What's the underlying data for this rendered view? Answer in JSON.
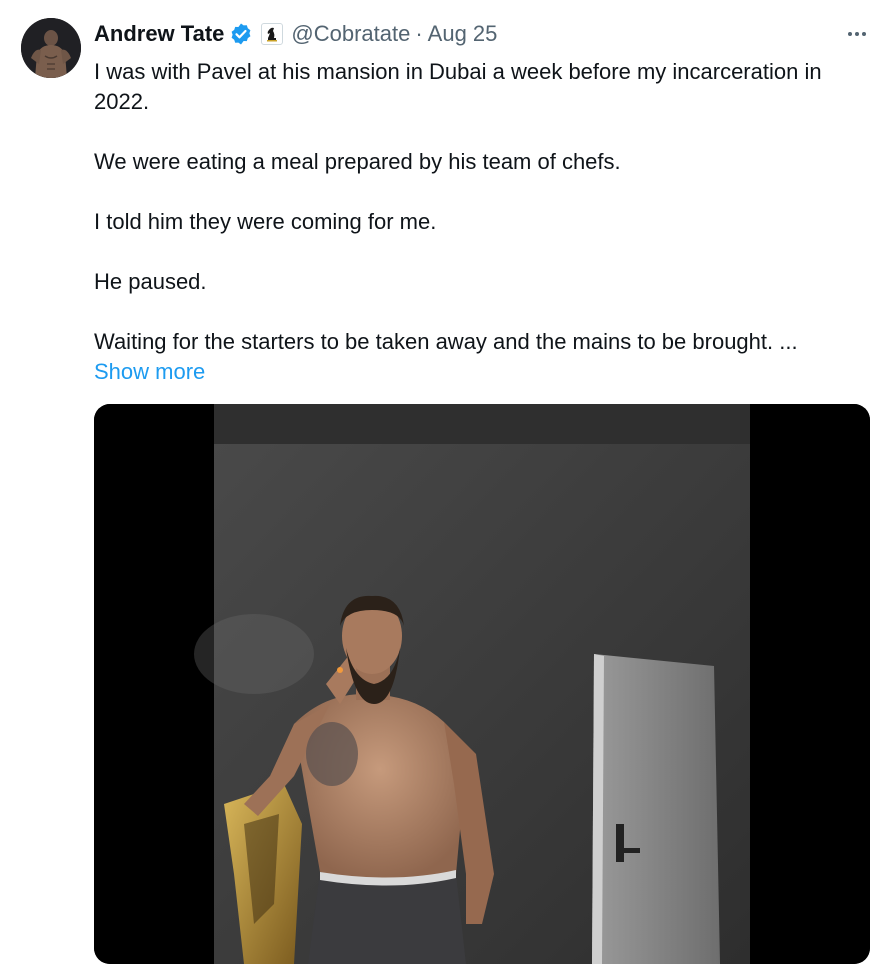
{
  "author": {
    "name": "Andrew Tate",
    "handle": "@Cobratate",
    "separator": "·",
    "date": "Aug 25",
    "verified_icon": "verified-badge-icon",
    "affiliate_icon": "chess-knight-icon"
  },
  "tweet": {
    "paragraphs": [
      "I was with Pavel at his mansion in Dubai a week before my incarceration in 2022.",
      "We were eating a meal prepared by his team of chefs.",
      "I told him they were coming for me.",
      "He paused.",
      "Waiting for the starters to be taken away and the mains to be brought. ..."
    ],
    "show_more_label": "Show more"
  },
  "colors": {
    "text": "#0f1419",
    "secondary": "#536471",
    "link": "#1d9bf0",
    "verified": "#1d9bf0"
  }
}
